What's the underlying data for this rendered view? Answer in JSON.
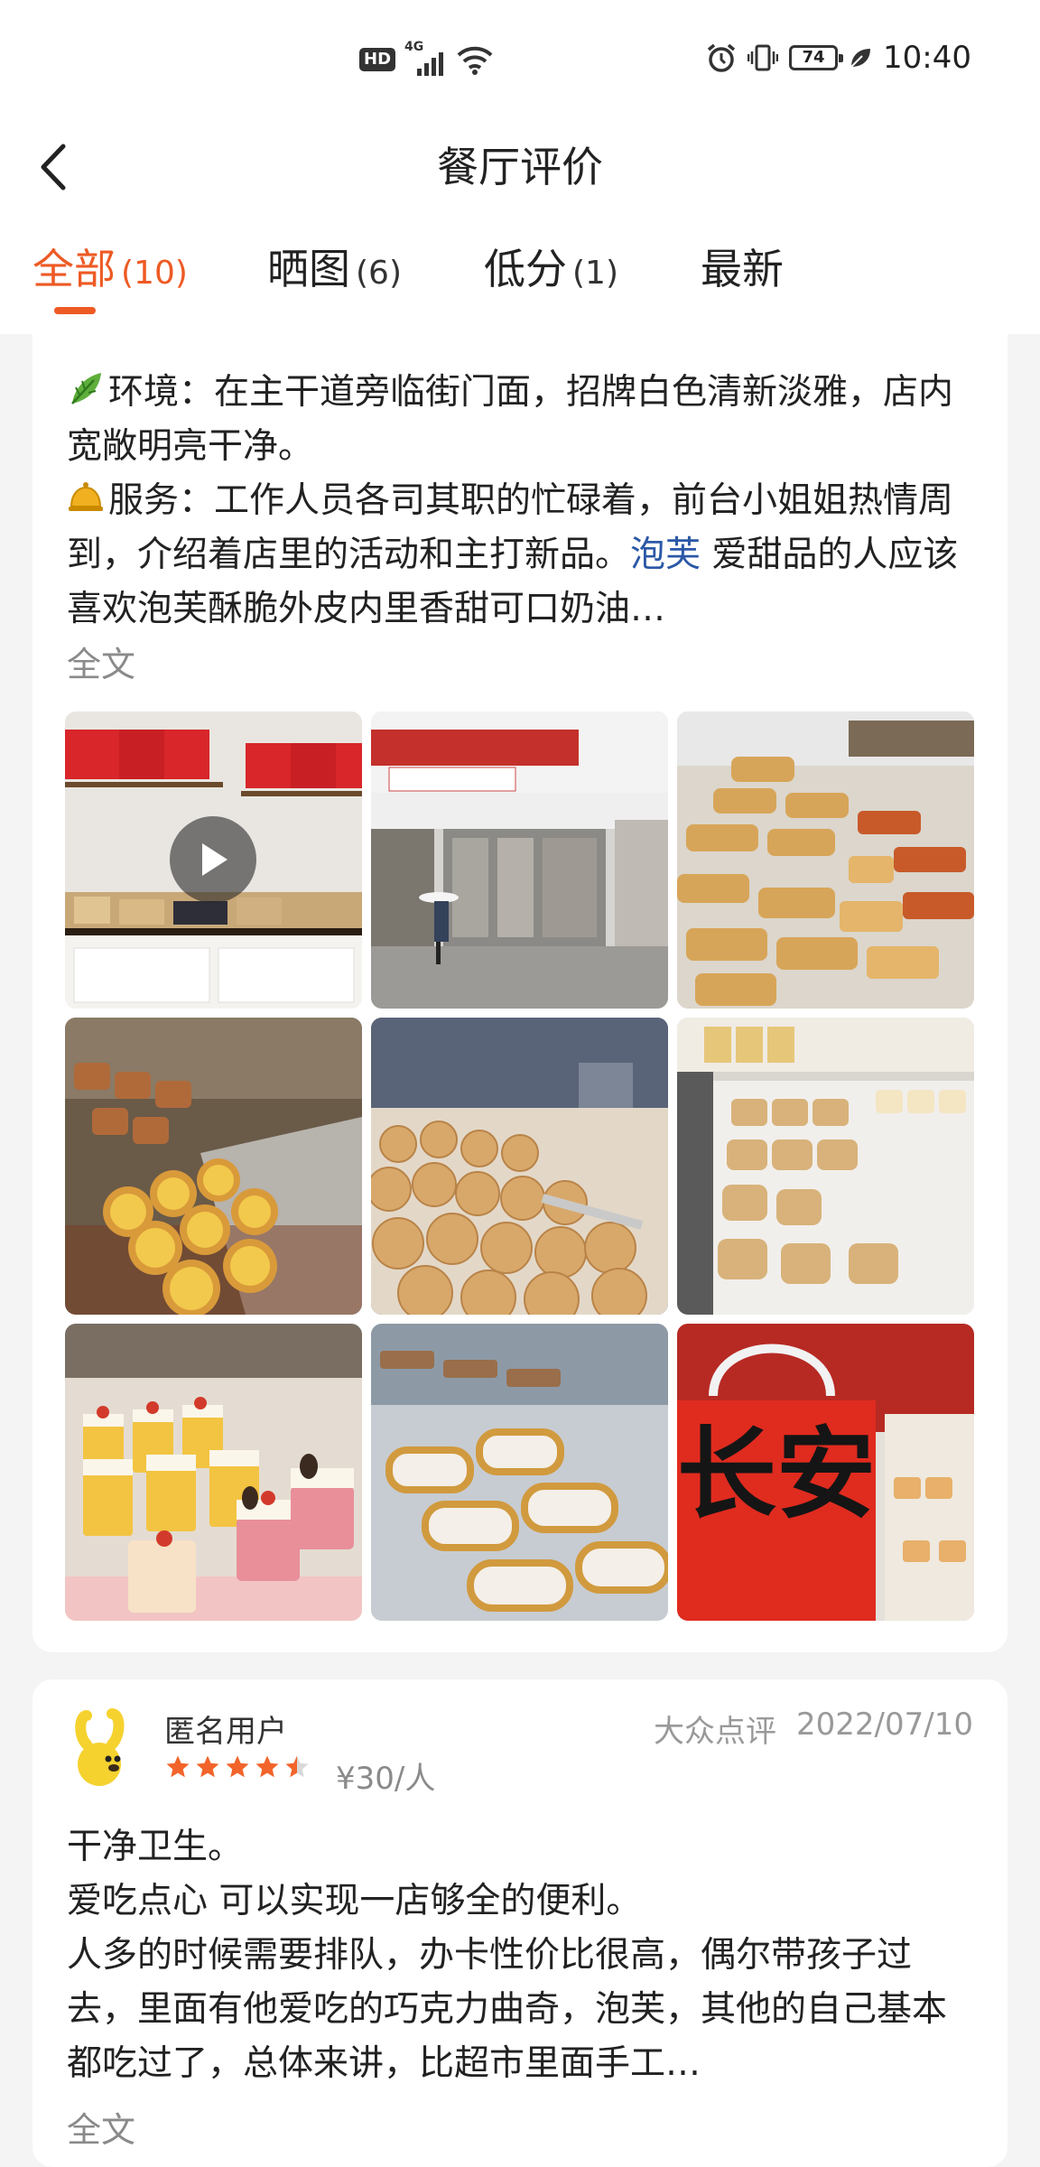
{
  "status_bar": {
    "hd": "HD",
    "network": "4G",
    "battery": "74",
    "time": "10:40"
  },
  "header": {
    "title": "餐厅评价",
    "back_icon": "chevron-left-icon"
  },
  "tabs": [
    {
      "label": "全部",
      "count": "(10)",
      "active": true
    },
    {
      "label": "晒图",
      "count": "(6)",
      "active": false
    },
    {
      "label": "低分",
      "count": "(1)",
      "active": false
    },
    {
      "label": "最新",
      "count": "",
      "active": false
    }
  ],
  "review1": {
    "env_prefix": "环境：",
    "env_text": "在主干道旁临街门面，招牌白色清新淡雅，店内宽敞明亮干净。",
    "svc_prefix": "服务：",
    "svc_text": "工作人员各司其职的忙碌着，前台小姐姐热情周到，介绍着店里的活动和主打新品。",
    "link_text": "泡芙",
    "tail_text": " 爱甜品的人应该喜欢泡芙酥脆外皮内里香甜可口奶油…",
    "more": "全文",
    "photos": [
      {
        "desc": "store-shelves",
        "has_video": true
      },
      {
        "desc": "storefront"
      },
      {
        "desc": "pastry-rolls"
      },
      {
        "desc": "egg-tarts"
      },
      {
        "desc": "cookies"
      },
      {
        "desc": "packaged-cakes"
      },
      {
        "desc": "mousse-cups"
      },
      {
        "desc": "roll-cakes"
      },
      {
        "desc": "red-bag"
      }
    ],
    "bag_text": "长安"
  },
  "review2": {
    "username": "匿名用户",
    "rating": 4.5,
    "price": "¥30/人",
    "source": "大众点评",
    "date": "2022/07/10",
    "lines": [
      "干净卫生。",
      "爱吃点心 可以实现一店够全的便利。",
      "人多的时候需要排队，办卡性价比很高，偶尔带孩子过去，里面有他爱吃的巧克力曲奇，泡芙，其他的自己基本都吃过了，总体来讲，比超市里面手工…"
    ],
    "more": "全文"
  },
  "colors": {
    "accent": "#ee5a24",
    "link": "#2b58a6",
    "star": "#f2642a"
  }
}
